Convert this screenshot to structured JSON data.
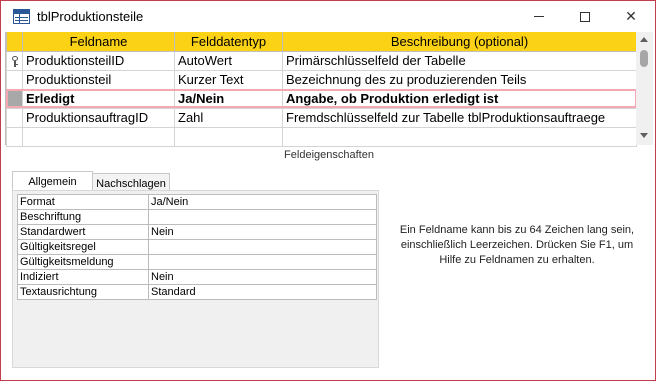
{
  "window": {
    "title": "tblProduktionsteile",
    "controls": {
      "minimize_icon": "minimize-icon",
      "maximize_icon": "maximize-icon",
      "close_icon": "close-icon",
      "close_glyph": "✕"
    },
    "table_icon": "table-icon"
  },
  "field_grid": {
    "columns": [
      "Feldname",
      "Felddatentyp",
      "Beschreibung (optional)"
    ],
    "rows": [
      {
        "name": "ProduktionsteilID",
        "type": "AutoWert",
        "description": "Primärschlüsselfeld der Tabelle",
        "primary_key": true
      },
      {
        "name": "Produktionsteil",
        "type": "Kurzer Text",
        "description": "Bezeichnung des zu produzierenden Teils"
      },
      {
        "name": "Erledigt",
        "type": "Ja/Nein",
        "description": "Angabe, ob Produktion erledigt ist",
        "selected": true
      },
      {
        "name": "ProduktionsauftragID",
        "type": "Zahl",
        "description": "Fremdschlüsselfeld zur Tabelle tblProduktionsauftraege"
      },
      {
        "name": "",
        "type": "",
        "description": ""
      }
    ]
  },
  "field_properties": {
    "section_title": "Feldeigenschaften",
    "tabs": [
      "Allgemein",
      "Nachschlagen"
    ],
    "active_tab": "Allgemein",
    "rows": [
      {
        "key": "Format",
        "value": "Ja/Nein"
      },
      {
        "key": "Beschriftung",
        "value": ""
      },
      {
        "key": "Standardwert",
        "value": "Nein"
      },
      {
        "key": "Gültigkeitsregel",
        "value": ""
      },
      {
        "key": "Gültigkeitsmeldung",
        "value": ""
      },
      {
        "key": "Indiziert",
        "value": "Nein"
      },
      {
        "key": "Textausrichtung",
        "value": "Standard"
      }
    ],
    "help_text": "Ein Feldname kann bis zu 64 Zeichen lang sein, einschließlich Leerzeichen. Drücken Sie F1, um Hilfe zu Feldnamen zu erhalten."
  },
  "colors": {
    "header_accent": "#fcd216",
    "window_border": "#c43b4e",
    "selected_row_outline": "#f3a8b4"
  }
}
